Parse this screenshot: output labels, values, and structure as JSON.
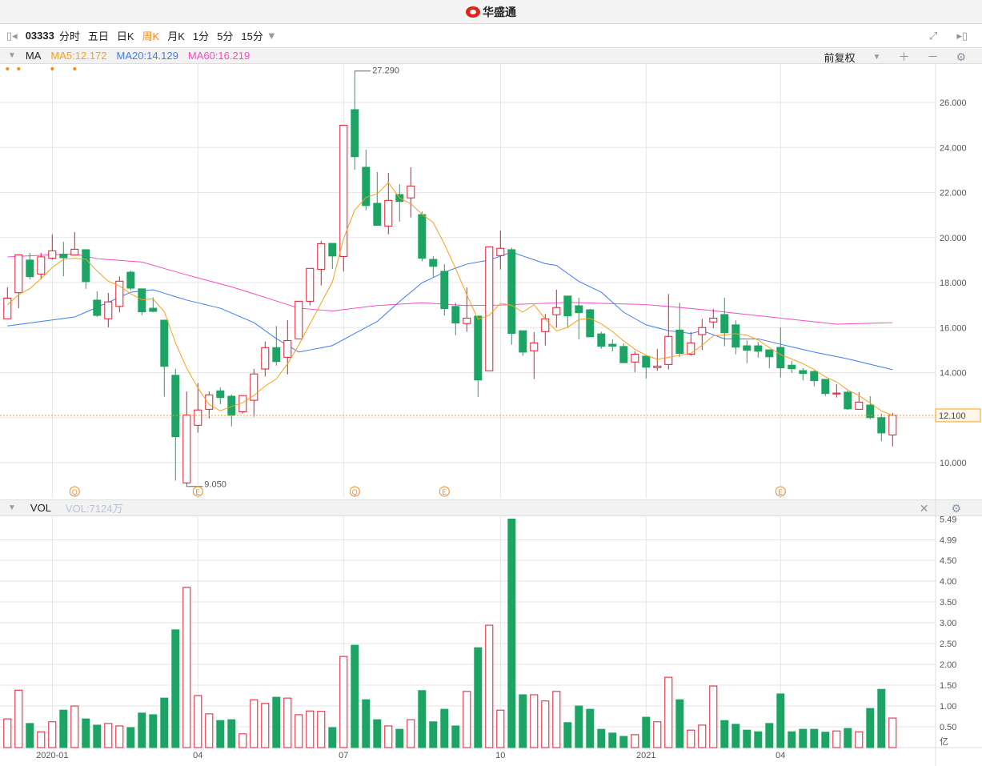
{
  "title_bar": {
    "brand": "华盛通"
  },
  "toolbar": {
    "stock_code": "03333",
    "periods": [
      "分时",
      "五日",
      "日K",
      "周K",
      "月K",
      "1分",
      "5分",
      "15分"
    ],
    "active_period": "周K"
  },
  "ma_bar": {
    "label": "MA",
    "ma5": "MA5:12.172",
    "ma20": "MA20:14.129",
    "ma60": "MA60:16.219",
    "adjust": "前复权"
  },
  "vol_bar": {
    "label": "VOL",
    "value": "VOL:7124万"
  },
  "colors": {
    "up": "#e5172c",
    "down": "#1ca464",
    "ma5": "#f5a11c",
    "ma20": "#3d7cf2",
    "ma60": "#f54cc0",
    "accent": "#f08a1c"
  },
  "chart_data": [
    {
      "type": "candlestick",
      "title": "03333 周K",
      "ylim": [
        8.5,
        28.2
      ],
      "y_ticks": [
        "26.000",
        "24.000",
        "22.000",
        "20.000",
        "18.000",
        "16.000",
        "14.000",
        "12.000",
        "10.000"
      ],
      "y_tick_values": [
        26,
        24,
        22,
        20,
        18,
        16,
        14,
        12,
        10
      ],
      "x_ticks": [
        {
          "label": "2020-01",
          "index": 4
        },
        {
          "label": "04",
          "index": 17
        },
        {
          "label": "07",
          "index": 30
        },
        {
          "label": "10",
          "index": 44
        },
        {
          "label": "2021",
          "index": 57
        },
        {
          "label": "04",
          "index": 69
        }
      ],
      "high_label": {
        "text": "27.290",
        "index": 31,
        "value": 27.29
      },
      "low_label": {
        "text": "9.050",
        "index": 16,
        "value": 9.05
      },
      "last_price": {
        "text": "12.100",
        "value": 12.1
      },
      "event_markers": [
        {
          "glyph": "Q",
          "index": 6
        },
        {
          "glyph": "E",
          "index": 17
        },
        {
          "glyph": "Q",
          "index": 31
        },
        {
          "glyph": "E",
          "index": 39
        },
        {
          "glyph": "E",
          "index": 69
        }
      ],
      "dividend_dots": [
        0,
        1,
        4,
        6
      ],
      "ohlc": [
        [
          16.39,
          17.79,
          16.39,
          17.31
        ],
        [
          17.55,
          19.23,
          16.86,
          19.23
        ],
        [
          19.0,
          19.32,
          18.14,
          18.26
        ],
        [
          18.38,
          19.32,
          18.14,
          19.14
        ],
        [
          19.08,
          20.14,
          19.02,
          19.41
        ],
        [
          19.26,
          19.81,
          18.28,
          19.1
        ],
        [
          19.22,
          20.24,
          19.22,
          19.48
        ],
        [
          19.46,
          19.46,
          17.72,
          18.04
        ],
        [
          17.22,
          17.61,
          16.47,
          16.54
        ],
        [
          16.39,
          17.54,
          16.01,
          17.14
        ],
        [
          16.94,
          18.27,
          16.68,
          18.06
        ],
        [
          18.46,
          18.54,
          17.66,
          17.75
        ],
        [
          17.72,
          17.72,
          16.55,
          16.7
        ],
        [
          16.86,
          17.34,
          16.68,
          16.72
        ],
        [
          16.33,
          16.33,
          12.93,
          14.28
        ],
        [
          13.88,
          14.16,
          9.2,
          11.15
        ],
        [
          9.1,
          13.16,
          9.05,
          12.12
        ],
        [
          11.66,
          13.54,
          11.33,
          12.34
        ],
        [
          12.37,
          13.16,
          11.97,
          13.01
        ],
        [
          13.19,
          13.34,
          12.6,
          12.89
        ],
        [
          12.95,
          13.03,
          11.61,
          12.1
        ],
        [
          12.26,
          12.98,
          12.18,
          12.98
        ],
        [
          12.77,
          14.16,
          12.04,
          13.94
        ],
        [
          14.16,
          15.38,
          13.82,
          15.11
        ],
        [
          15.11,
          16.07,
          14.31,
          14.49
        ],
        [
          14.68,
          16.33,
          13.92,
          15.42
        ],
        [
          15.5,
          17.17,
          15.5,
          17.17
        ],
        [
          17.17,
          18.63,
          16.98,
          18.63
        ],
        [
          18.59,
          19.85,
          17.87,
          19.73
        ],
        [
          19.74,
          19.74,
          18.6,
          19.18
        ],
        [
          19.16,
          24.99,
          18.49,
          24.99
        ],
        [
          25.68,
          27.29,
          23.02,
          23.59
        ],
        [
          23.12,
          23.9,
          21.21,
          21.42
        ],
        [
          21.52,
          22.91,
          20.54,
          20.54
        ],
        [
          20.51,
          22.87,
          20.14,
          21.65
        ],
        [
          21.91,
          22.37,
          20.71,
          21.6
        ],
        [
          21.76,
          23.12,
          20.89,
          22.29
        ],
        [
          21.02,
          21.16,
          18.94,
          19.08
        ],
        [
          19.03,
          19.17,
          18.25,
          18.72
        ],
        [
          18.5,
          18.82,
          16.54,
          16.84
        ],
        [
          16.94,
          17.1,
          15.66,
          16.2
        ],
        [
          16.18,
          17.78,
          15.81,
          16.42
        ],
        [
          16.51,
          16.51,
          12.92,
          13.67
        ],
        [
          14.08,
          19.59,
          14.08,
          19.59
        ],
        [
          19.2,
          20.31,
          18.58,
          19.52
        ],
        [
          19.46,
          19.55,
          15.24,
          15.74
        ],
        [
          15.86,
          15.86,
          14.74,
          14.91
        ],
        [
          14.97,
          15.8,
          13.72,
          15.32
        ],
        [
          15.82,
          16.6,
          15.2,
          16.39
        ],
        [
          16.57,
          17.68,
          16.0,
          16.89
        ],
        [
          17.4,
          17.4,
          16.0,
          16.52
        ],
        [
          16.97,
          17.32,
          15.48,
          16.66
        ],
        [
          16.79,
          16.83,
          15.59,
          15.59
        ],
        [
          15.72,
          15.82,
          15.06,
          15.17
        ],
        [
          15.26,
          15.48,
          14.94,
          15.17
        ],
        [
          15.16,
          15.3,
          14.42,
          14.44
        ],
        [
          14.47,
          14.94,
          14.02,
          14.82
        ],
        [
          14.73,
          14.73,
          13.74,
          14.24
        ],
        [
          14.22,
          15.05,
          14.08,
          14.29
        ],
        [
          14.36,
          17.49,
          14.14,
          15.61
        ],
        [
          15.89,
          17.1,
          14.7,
          14.85
        ],
        [
          14.82,
          15.8,
          14.75,
          15.32
        ],
        [
          15.69,
          16.39,
          15.0,
          16.0
        ],
        [
          16.25,
          16.83,
          15.97,
          16.42
        ],
        [
          16.58,
          17.32,
          15.17,
          15.77
        ],
        [
          16.12,
          16.32,
          14.81,
          15.13
        ],
        [
          15.19,
          15.43,
          14.42,
          14.99
        ],
        [
          15.19,
          15.36,
          14.66,
          14.95
        ],
        [
          15.01,
          15.01,
          14.2,
          14.7
        ],
        [
          15.12,
          16.01,
          13.78,
          14.21
        ],
        [
          14.33,
          14.52,
          13.99,
          14.17
        ],
        [
          14.09,
          14.2,
          13.66,
          13.96
        ],
        [
          14.05,
          14.1,
          13.39,
          13.64
        ],
        [
          13.7,
          13.7,
          12.96,
          13.07
        ],
        [
          13.05,
          13.48,
          12.89,
          13.09
        ],
        [
          13.13,
          13.2,
          12.35,
          12.39
        ],
        [
          12.37,
          13.13,
          12.37,
          12.69
        ],
        [
          12.56,
          12.95,
          11.93,
          12.0
        ],
        [
          12.0,
          12.17,
          10.96,
          11.32
        ],
        [
          11.23,
          12.2,
          10.72,
          12.1
        ]
      ],
      "ma5_first": 16.93,
      "ma20_points": [
        [
          0,
          16.07
        ],
        [
          6,
          16.47
        ],
        [
          8,
          16.9
        ],
        [
          11,
          17.57
        ],
        [
          13,
          17.68
        ],
        [
          16,
          17.22
        ],
        [
          19,
          16.86
        ],
        [
          22,
          16.22
        ],
        [
          24,
          15.51
        ],
        [
          26,
          14.91
        ],
        [
          29,
          15.2
        ],
        [
          31,
          15.74
        ],
        [
          33,
          16.27
        ],
        [
          35,
          17.16
        ],
        [
          37,
          17.99
        ],
        [
          39,
          18.46
        ],
        [
          41,
          18.82
        ],
        [
          43,
          19.0
        ],
        [
          45,
          19.35
        ],
        [
          48,
          18.84
        ],
        [
          49,
          18.76
        ],
        [
          51,
          18.05
        ],
        [
          53,
          17.57
        ],
        [
          55,
          16.68
        ],
        [
          57,
          16.12
        ],
        [
          59,
          15.86
        ],
        [
          61,
          15.74
        ],
        [
          62,
          15.86
        ],
        [
          64,
          15.5
        ],
        [
          67,
          15.5
        ],
        [
          69,
          15.26
        ],
        [
          72,
          14.91
        ],
        [
          75,
          14.61
        ],
        [
          79,
          14.13
        ]
      ],
      "ma60_points": [
        [
          0,
          19.14
        ],
        [
          4,
          19.23
        ],
        [
          6,
          19.27
        ],
        [
          8,
          19.06
        ],
        [
          12,
          18.91
        ],
        [
          16,
          18.34
        ],
        [
          20,
          17.81
        ],
        [
          23,
          17.34
        ],
        [
          26,
          16.86
        ],
        [
          29,
          16.74
        ],
        [
          33,
          16.98
        ],
        [
          37,
          17.1
        ],
        [
          41,
          16.98
        ],
        [
          44,
          17.0
        ],
        [
          50,
          17.12
        ],
        [
          57,
          17.02
        ],
        [
          61,
          16.85
        ],
        [
          62,
          16.8
        ],
        [
          69,
          16.42
        ],
        [
          74,
          16.15
        ],
        [
          79,
          16.22
        ]
      ]
    },
    {
      "type": "bar",
      "title": "VOL",
      "unit": "亿",
      "ylim": [
        0,
        5.49
      ],
      "y_ticks": [
        "5.49",
        "4.99",
        "4.50",
        "4.00",
        "3.50",
        "3.00",
        "2.50",
        "2.00",
        "1.50",
        "1.00",
        "0.50"
      ],
      "y_tick_values": [
        5.49,
        4.99,
        4.5,
        4.0,
        3.5,
        3.0,
        2.5,
        2.0,
        1.5,
        1.0,
        0.5
      ],
      "values": [
        0.69,
        1.38,
        0.58,
        0.38,
        0.62,
        0.9,
        1.0,
        0.69,
        0.54,
        0.58,
        0.52,
        0.48,
        0.83,
        0.79,
        1.19,
        2.83,
        3.85,
        1.25,
        0.81,
        0.65,
        0.67,
        0.33,
        1.15,
        1.06,
        1.21,
        1.19,
        0.79,
        0.88,
        0.87,
        0.48,
        2.19,
        2.46,
        1.15,
        0.67,
        0.52,
        0.44,
        0.67,
        1.37,
        0.62,
        0.92,
        0.52,
        1.35,
        2.4,
        2.94,
        0.9,
        5.49,
        1.27,
        1.27,
        1.12,
        1.35,
        0.6,
        1.0,
        0.92,
        0.44,
        0.35,
        0.27,
        0.31,
        0.73,
        0.62,
        1.69,
        1.15,
        0.42,
        0.54,
        1.48,
        0.65,
        0.56,
        0.42,
        0.38,
        0.58,
        1.29,
        0.38,
        0.44,
        0.44,
        0.37,
        0.4,
        0.46,
        0.38,
        0.94,
        1.4,
        0.71
      ]
    }
  ]
}
